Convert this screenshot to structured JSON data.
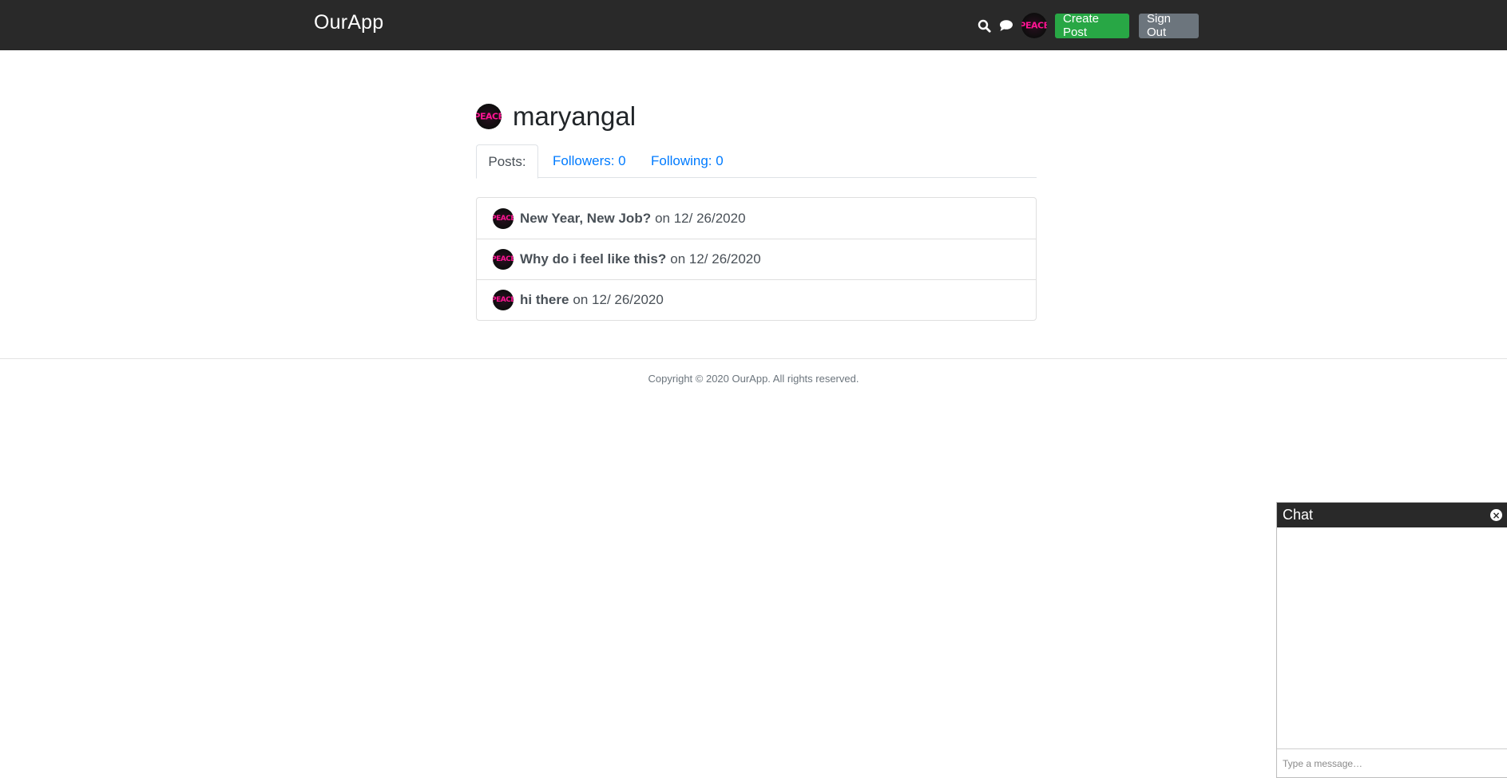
{
  "header": {
    "brand": "OurApp",
    "search_icon": "search-icon",
    "chat_icon": "chat-bubble-icon",
    "avatar_text": "PEACE",
    "create_post_label": "Create Post",
    "sign_out_label": "Sign Out"
  },
  "profile": {
    "username": "maryangal",
    "avatar_text": "PEACE",
    "tabs": [
      {
        "label": "Posts:"
      },
      {
        "label": "Followers: 0"
      },
      {
        "label": "Following: 0"
      }
    ],
    "posts": [
      {
        "title": "New Year, New Job?",
        "date": "on 12/ 26/2020"
      },
      {
        "title": "Why do i feel like this?",
        "date": "on 12/ 26/2020"
      },
      {
        "title": "hi there",
        "date": "on 12/ 26/2020"
      }
    ]
  },
  "footer": {
    "copyright": "Copyright © 2020 OurApp. All rights reserved."
  },
  "chat": {
    "title": "Chat",
    "close_icon": "close-circle-icon",
    "input_placeholder": "Type a message…"
  },
  "colors": {
    "navbar": "#292929",
    "primary_link": "#007bff",
    "create_post": "#28a745",
    "sign_out": "#6c757d",
    "avatar_accent": "#ff1493"
  }
}
